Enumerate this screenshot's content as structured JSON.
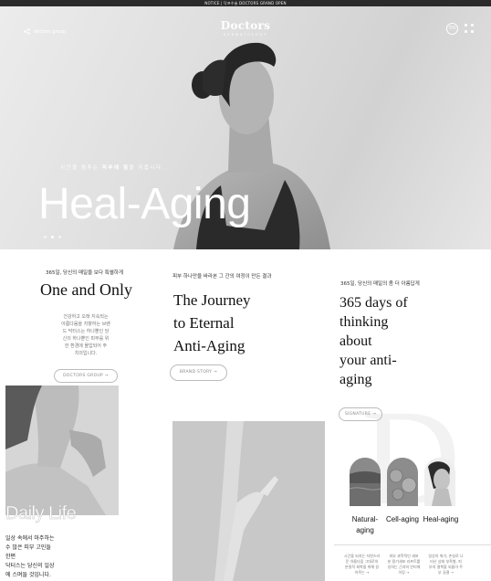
{
  "notice": {
    "text": "NOTICE  |  닥프수술 DOCTORS GRAND OPEN"
  },
  "hero": {
    "group_label": "doctors group",
    "brand": "Doctors",
    "brand_sub": "DERMATOLOGY",
    "circle_label": "EN",
    "tagline_pre": "시간을 멈추는 ",
    "tagline_bold": "피부에 힘",
    "tagline_post": "을 키웁니다.",
    "headline": "Heal-Aging",
    "slides": 3,
    "active_slide": 2
  },
  "col1": {
    "kicker": "365일, 당신의 매일을 보다 특별하게",
    "title": "One and Only",
    "paragraph": [
      "건강하고 오래 지속되는",
      "아름다움을 지향하는 브랜",
      "드 닥터스는 하나뿐인 당",
      "신의 하나뿐인 피부를 위",
      "한 환경에 몰입되어 주",
      "치의입니다."
    ],
    "button": "DOCTORS GROUP →",
    "image_caption": "Daily Life",
    "body": [
      "일상 속에서 마주하는",
      "수 많은 피부 고민들",
      "한편",
      "닥터스는 당신의 일상",
      "에 스며들 것입니다."
    ]
  },
  "col2": {
    "kicker": "피부 하나만을 바라본 그 간의 여정이 만든 결과",
    "title": [
      "The Journey",
      "to Eternal",
      "Anti-Aging"
    ],
    "button": "BRAND STORY →"
  },
  "col3": {
    "kicker": "365일, 당신의 매일의 좀 더 아름답게",
    "title": [
      "365 days of",
      "thinking",
      "about",
      "your anti-",
      "aging"
    ],
    "button": "SIGNATURE →",
    "watermark": "D",
    "cards": [
      {
        "label_l1": "Natural-",
        "label_l2": "aging"
      },
      {
        "label_l1": "Cell-aging",
        "label_l2": ""
      },
      {
        "label_l1": "Heal-aging",
        "label_l2": ""
      }
    ],
    "mini": [
      [
        "시간을 되지는 자연스러",
        "운 아름다움 그대로의",
        "본질적 회복을 위해 걸",
        "어주는 →"
      ],
      [
        "피부 과학적인 세포",
        "분 용기세포 리프트를",
        "성하는 근과의 안티에",
        "이징 →"
      ],
      [
        "일상의 위기, 손실로 나",
        "타난 상태 부족형, 피",
        "부의 결복을 되돌아 주",
        "부 길결 →"
      ]
    ]
  }
}
